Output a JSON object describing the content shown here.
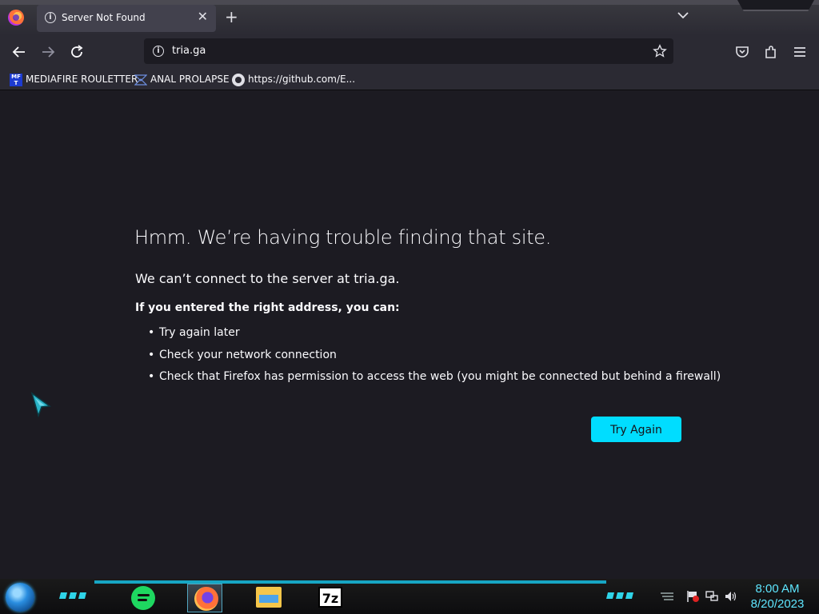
{
  "browser": {
    "tab": {
      "title": "Server Not Found",
      "close_glyph": "✕"
    },
    "new_tab_glyph": "+",
    "url": "tria.ga",
    "bookmarks": [
      {
        "label": "MEDIAFIRE ROULETTER",
        "icon": "mediafire-icon"
      },
      {
        "label": "ANAL PROLAPSE",
        "icon": "bookmark-folder-icon"
      },
      {
        "label": "https://github.com/E...",
        "icon": "github-icon"
      }
    ]
  },
  "error_page": {
    "title": "Hmm. We’re having trouble finding that site.",
    "subtitle": "We can’t connect to the server at tria.ga.",
    "lead": "If you entered the right address, you can:",
    "suggestions": [
      "Try again later",
      "Check your network connection",
      "Check that Firefox has permission to access the web (you might be connected but behind a firewall)"
    ],
    "button_label": "Try Again"
  },
  "taskbar": {
    "apps": [
      "spotify-icon",
      "firefox-icon",
      "file-explorer-icon",
      "7zip-icon"
    ],
    "sevenzip_label": "7z",
    "clock": {
      "time": "8:00 AM",
      "date": "8/20/2023"
    }
  },
  "colors": {
    "accent": "#00ddff",
    "page_bg": "#1c1b22",
    "toolbar_bg": "#2b2a33",
    "clock": "#5ee6ff"
  }
}
